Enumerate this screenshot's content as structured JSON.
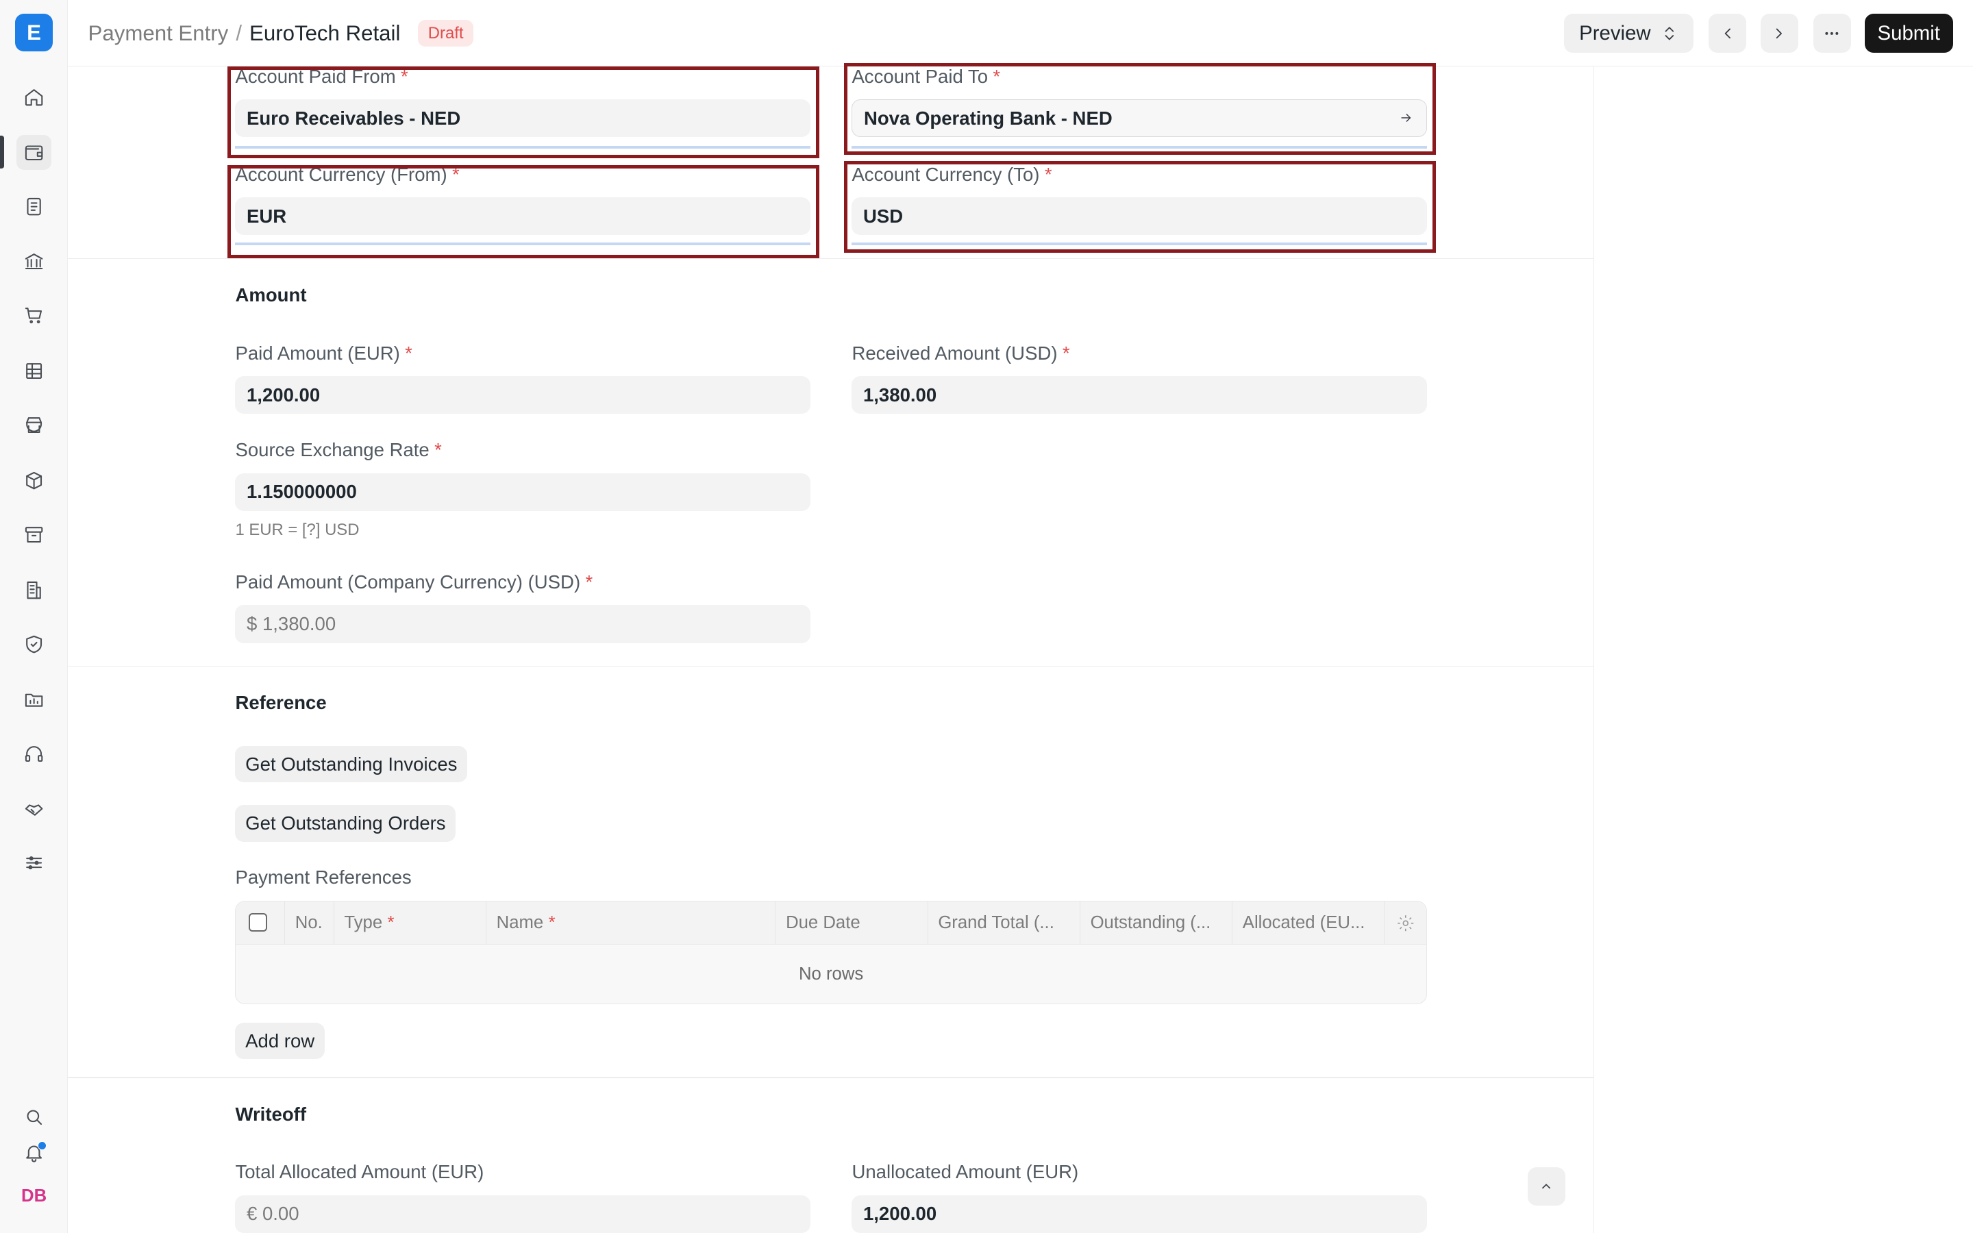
{
  "header": {
    "breadcrumb_parent": "Payment Entry",
    "breadcrumb_sep": "/",
    "breadcrumb_current": "EuroTech Retail",
    "status_badge": "Draft",
    "preview_label": "Preview",
    "submit_label": "Submit"
  },
  "sidebar": {
    "logo_letter": "E",
    "avatar_initials": "DB",
    "items": [
      "home-icon",
      "wallet-icon",
      "document-icon",
      "bank-icon",
      "cart-icon",
      "table-icon",
      "store-icon",
      "package-icon",
      "archive-icon",
      "building-icon",
      "shield-icon",
      "folder-chart-icon",
      "headset-icon",
      "handshake-icon",
      "sliders-icon"
    ]
  },
  "accounts": {
    "paid_from_label": "Account Paid From",
    "paid_from_value": "Euro Receivables - NED",
    "paid_to_label": "Account Paid To",
    "paid_to_value": "Nova Operating Bank - NED",
    "currency_from_label": "Account Currency (From)",
    "currency_from_value": "EUR",
    "currency_to_label": "Account Currency (To)",
    "currency_to_value": "USD"
  },
  "amount": {
    "section_title": "Amount",
    "paid_amount_label": "Paid Amount (EUR)",
    "paid_amount_value": "1,200.00",
    "received_amount_label": "Received Amount (USD)",
    "received_amount_value": "1,380.00",
    "exchange_rate_label": "Source Exchange Rate",
    "exchange_rate_value": "1.150000000",
    "exchange_rate_help": "1 EUR = [?] USD",
    "company_amount_label": "Paid Amount (Company Currency) (USD)",
    "company_amount_value": "$ 1,380.00"
  },
  "reference": {
    "section_title": "Reference",
    "get_invoices_label": "Get Outstanding Invoices",
    "get_orders_label": "Get Outstanding Orders",
    "table_title": "Payment References",
    "columns": [
      "No.",
      "Type",
      "Name",
      "Due Date",
      "Grand Total (...",
      "Outstanding (...",
      "Allocated (EU..."
    ],
    "no_rows": "No rows",
    "add_row_label": "Add row"
  },
  "writeoff": {
    "section_title": "Writeoff",
    "total_allocated_label": "Total Allocated Amount (EUR)",
    "total_allocated_value": "€ 0.00",
    "unallocated_label": "Unallocated Amount (EUR)",
    "unallocated_value": "1,200.00"
  }
}
